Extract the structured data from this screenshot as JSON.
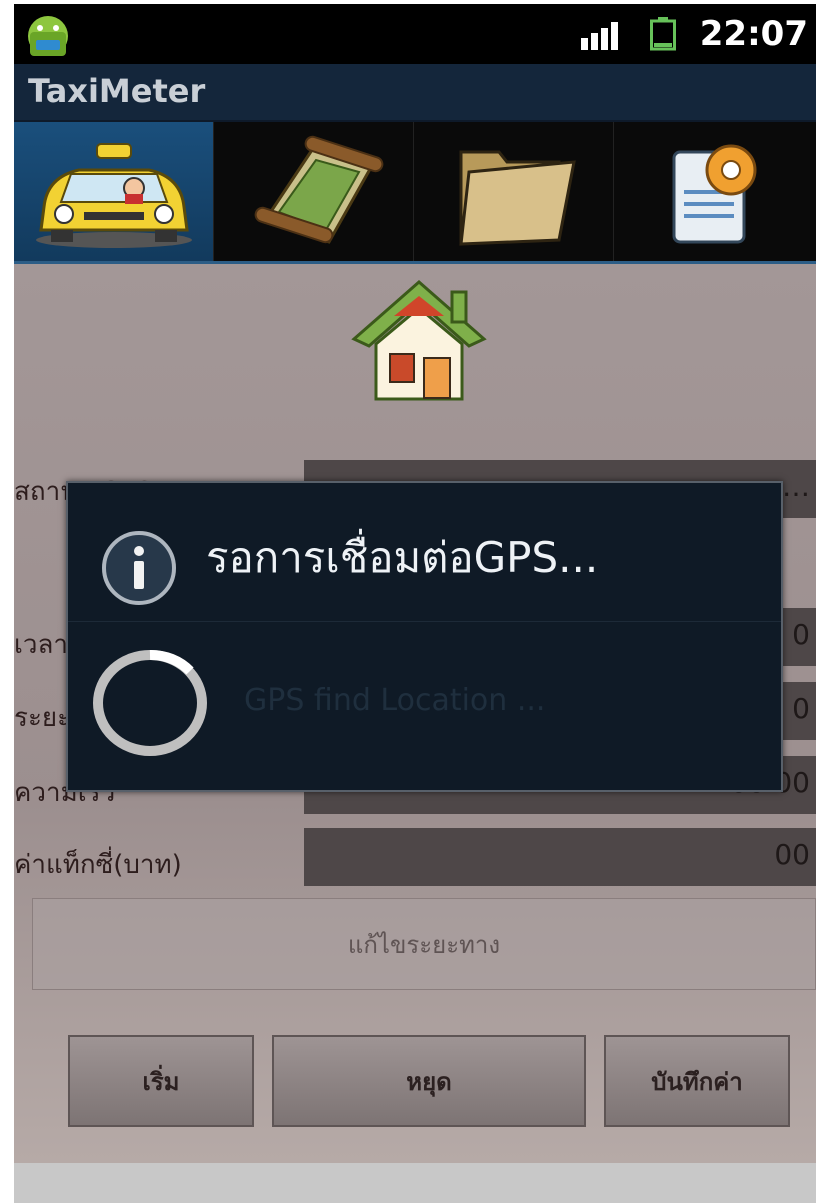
{
  "status_bar": {
    "time": "22:07"
  },
  "app": {
    "title": "TaxiMeter"
  },
  "tabs": [
    {
      "name": "taxi",
      "icon": "taxi-icon",
      "active": true
    },
    {
      "name": "map",
      "icon": "map-scroll-icon",
      "active": false
    },
    {
      "name": "files",
      "icon": "folder-icon",
      "active": false
    },
    {
      "name": "settings",
      "icon": "settings-document-icon",
      "active": false
    }
  ],
  "form": {
    "rows": [
      {
        "label": "สถานะ GPS",
        "value": "…"
      },
      {
        "label": "เวลา",
        "value": "0"
      },
      {
        "label": "ระยะทาง",
        "value": "0"
      },
      {
        "label": "ความเร็ว",
        "value": "00.00"
      },
      {
        "label": "ค่าแท็กซี่(บาท)",
        "value": "00"
      }
    ],
    "edit_distance_label": "แก้ไขระยะทาง",
    "buttons": {
      "start": "เริ่ม",
      "stop": "หยุด",
      "save": "บันทึกค่า"
    }
  },
  "dialog": {
    "title": "รอการเชื่อมต่อGPS...",
    "message": "GPS find Location ..."
  }
}
